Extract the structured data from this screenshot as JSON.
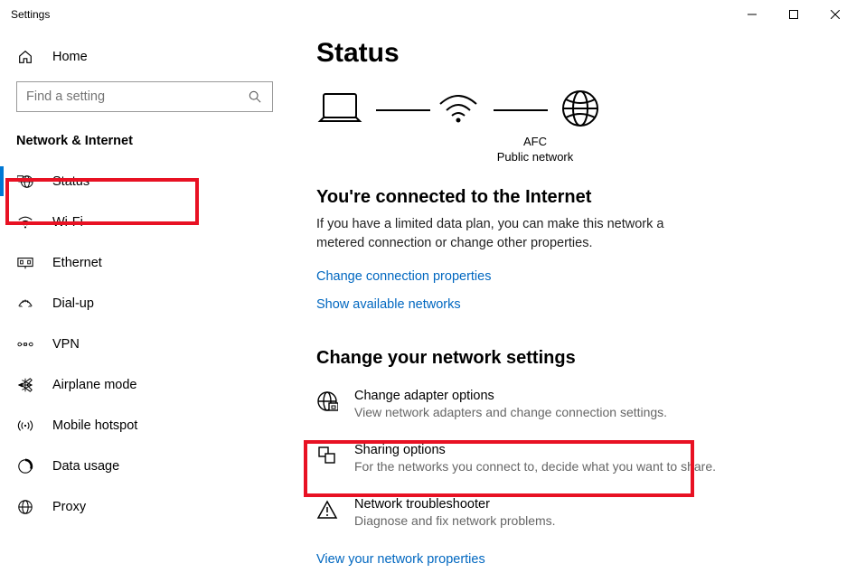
{
  "window": {
    "title": "Settings"
  },
  "sidebar": {
    "home_label": "Home",
    "search_placeholder": "Find a setting",
    "section_label": "Network & Internet",
    "items": [
      {
        "label": "Status",
        "icon": "globe-status"
      },
      {
        "label": "Wi-Fi",
        "icon": "wifi"
      },
      {
        "label": "Ethernet",
        "icon": "ethernet"
      },
      {
        "label": "Dial-up",
        "icon": "dialup"
      },
      {
        "label": "VPN",
        "icon": "vpn"
      },
      {
        "label": "Airplane mode",
        "icon": "airplane"
      },
      {
        "label": "Mobile hotspot",
        "icon": "hotspot"
      },
      {
        "label": "Data usage",
        "icon": "data-usage"
      },
      {
        "label": "Proxy",
        "icon": "globe"
      }
    ]
  },
  "content": {
    "title": "Status",
    "net_name": "AFC",
    "net_type": "Public network",
    "connected_heading": "You're connected to the Internet",
    "connected_body": "If you have a limited data plan, you can make this network a metered connection or change other properties.",
    "change_props_link": "Change connection properties",
    "show_networks_link": "Show available networks",
    "settings_heading": "Change your network settings",
    "options": [
      {
        "title": "Change adapter options",
        "desc": "View network adapters and change connection settings."
      },
      {
        "title": "Sharing options",
        "desc": "For the networks you connect to, decide what you want to share."
      },
      {
        "title": "Network troubleshooter",
        "desc": "Diagnose and fix network problems."
      }
    ],
    "view_props_link": "View your network properties"
  }
}
